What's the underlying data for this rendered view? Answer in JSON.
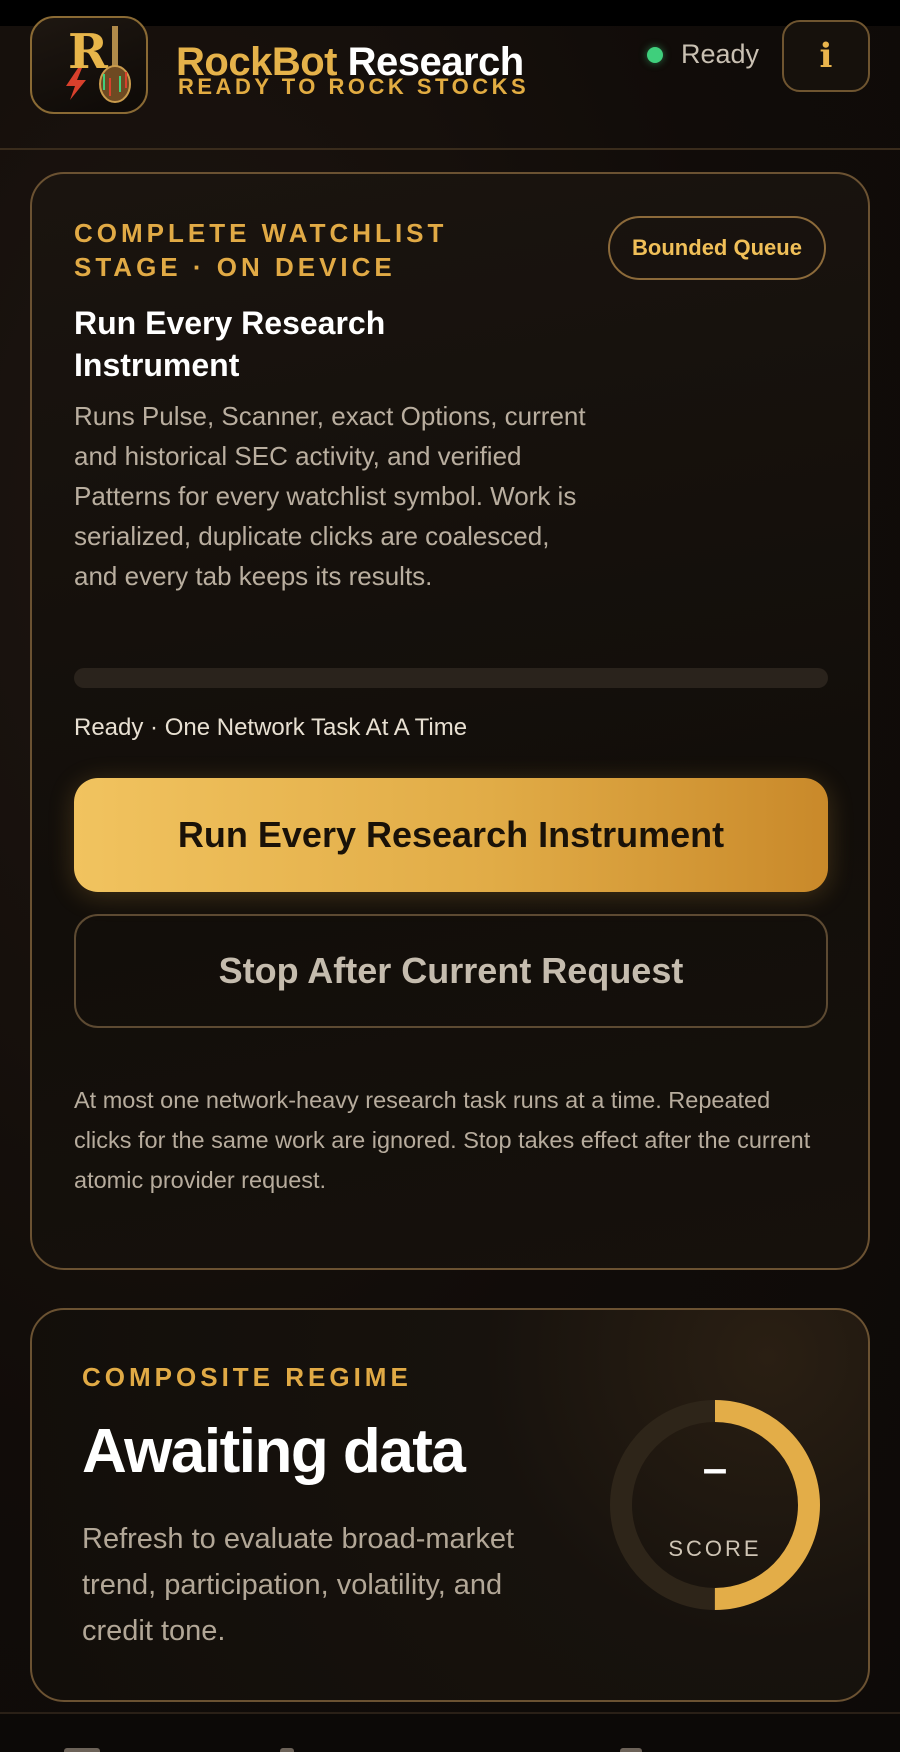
{
  "header": {
    "brand_part1": "RockBot",
    "brand_part2": " Research",
    "tagline": "READY TO ROCK STOCKS",
    "status": "Ready",
    "info_label": "i",
    "colors": {
      "accent": "#e3ad48",
      "status_ok": "#3fcf7c"
    }
  },
  "watchlist_card": {
    "eyebrow": "COMPLETE WATCHLIST STAGE · ON DEVICE",
    "badge": "Bounded Queue",
    "title": "Run Every Research Instrument",
    "description": "Runs Pulse, Scanner, exact Options, current and historical SEC activity, and verified Patterns for every watchlist symbol. Work is serialized, duplicate clicks are coalesced, and every tab keeps its results.",
    "progress_fraction": 0,
    "progress_label": "Ready · One Network Task At A Time",
    "primary_button": "Run Every Research Instrument",
    "secondary_button": "Stop After Current Request",
    "note": "At most one network-heavy research task runs at a time. Repeated clicks for the same work are ignored. Stop takes effect after the current atomic provider request."
  },
  "regime_card": {
    "eyebrow": "COMPOSITE REGIME",
    "title": "Awaiting data",
    "description": "Refresh to evaluate broad-market trend, participation, volatility, and credit tone.",
    "gauge_value": "–",
    "gauge_label": "SCORE",
    "gauge_fraction": 0.5
  }
}
